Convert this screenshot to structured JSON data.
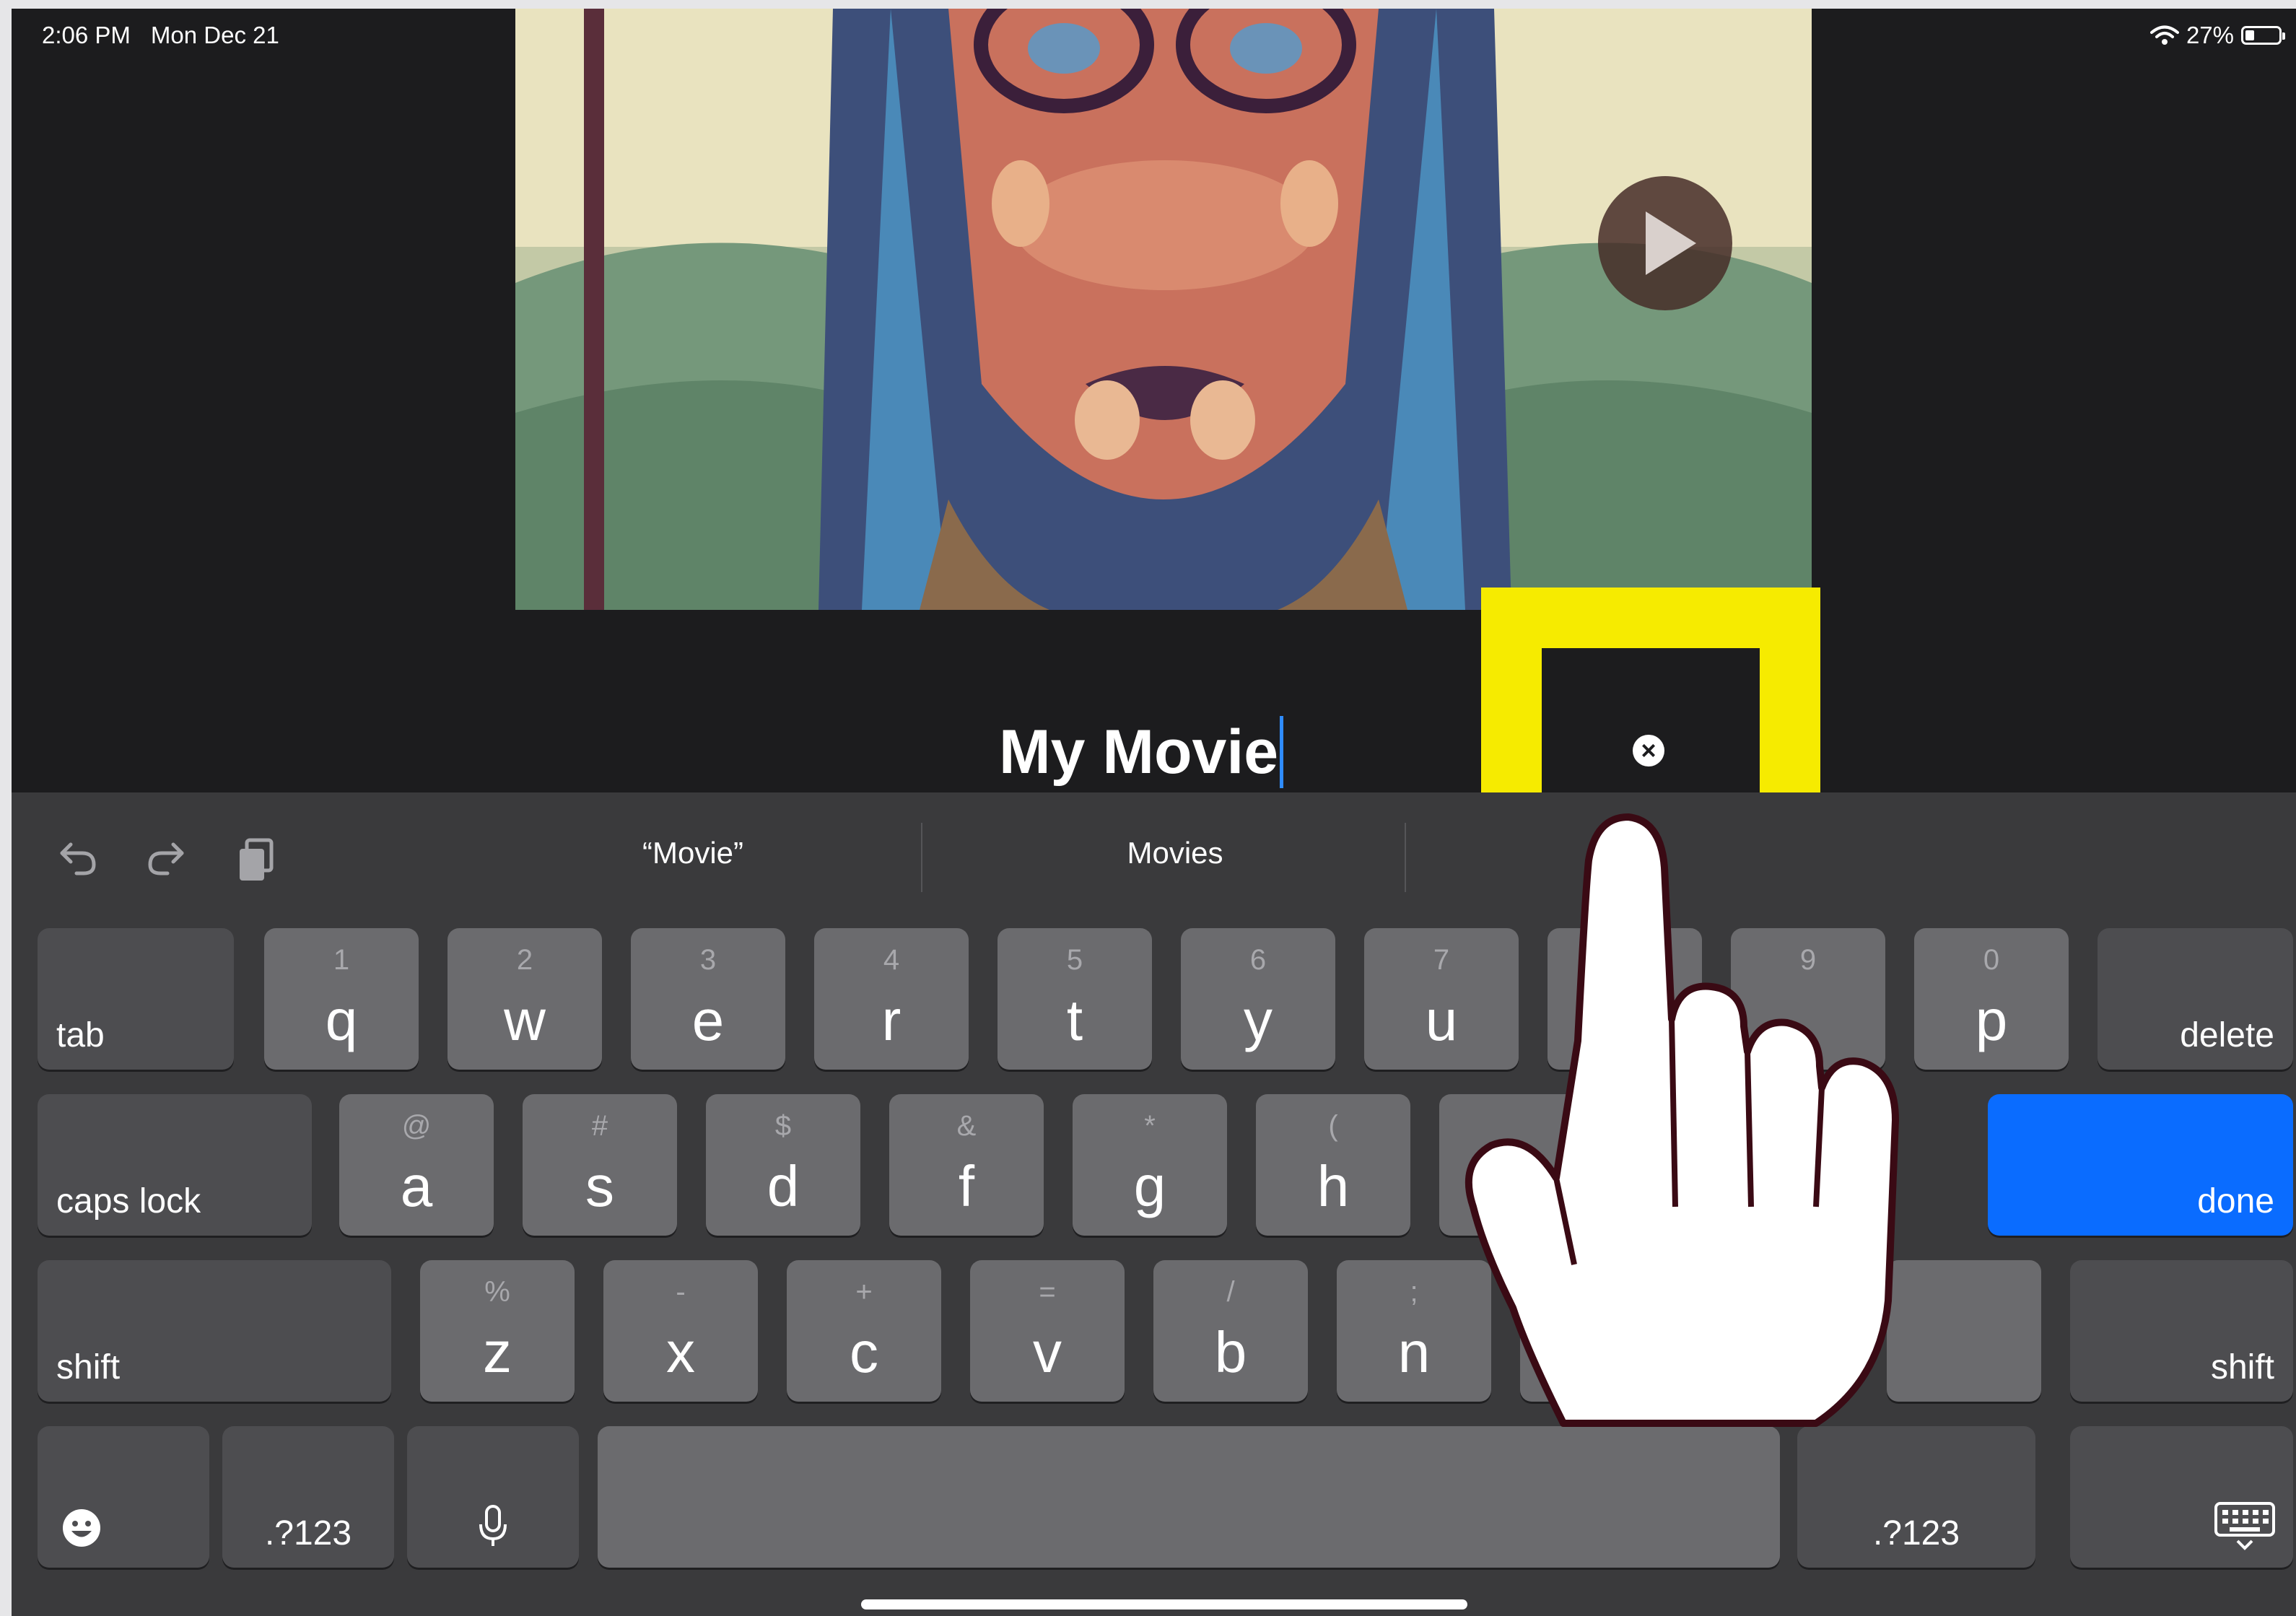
{
  "status_bar": {
    "time": "2:06 PM",
    "date": "Mon Dec 21",
    "battery_percent": "27%",
    "battery_level": 0.27
  },
  "project": {
    "title": "My Movie"
  },
  "clear_button": {
    "glyph": "×"
  },
  "suggestions": [
    "“Movie”",
    "Movies"
  ],
  "keyboard": {
    "row1": [
      {
        "hint": "1",
        "key": "q"
      },
      {
        "hint": "2",
        "key": "w"
      },
      {
        "hint": "3",
        "key": "e"
      },
      {
        "hint": "4",
        "key": "r"
      },
      {
        "hint": "5",
        "key": "t"
      },
      {
        "hint": "6",
        "key": "y"
      },
      {
        "hint": "7",
        "key": "u"
      },
      {
        "hint": "",
        "key": ""
      },
      {
        "hint": "9",
        "key": ""
      },
      {
        "hint": "0",
        "key": "p"
      }
    ],
    "row2": [
      {
        "hint": "@",
        "key": "a"
      },
      {
        "hint": "#",
        "key": "s"
      },
      {
        "hint": "$",
        "key": "d"
      },
      {
        "hint": "&",
        "key": "f"
      },
      {
        "hint": "*",
        "key": "g"
      },
      {
        "hint": "(",
        "key": "h"
      }
    ],
    "row3": [
      {
        "hint": "%",
        "key": "z"
      },
      {
        "hint": "-",
        "key": "x"
      },
      {
        "hint": "+",
        "key": "c"
      },
      {
        "hint": "=",
        "key": "v"
      },
      {
        "hint": "/",
        "key": "b"
      },
      {
        "hint": ";",
        "key": "n"
      }
    ],
    "tab": "tab",
    "delete": "delete",
    "caps_lock": "caps lock",
    "done": "done",
    "shift": "shift",
    "numbers": ".?123"
  },
  "icons": [
    "undo-icon",
    "redo-icon",
    "paste-icon",
    "clear-text-icon",
    "play-icon",
    "emoji-icon",
    "microphone-icon",
    "keyboard-dismiss-icon",
    "wifi-icon",
    "battery-icon",
    "pointing-hand-icon"
  ],
  "colors": {
    "screen_bg": "#1c1c1e",
    "keyboard_bg": "#3a3a3c",
    "key": "#6b6b6e",
    "key_fn": "#4d4d50",
    "done": "#0a6cff",
    "highlight": "#f6eb00",
    "caret": "#2f8cff"
  }
}
